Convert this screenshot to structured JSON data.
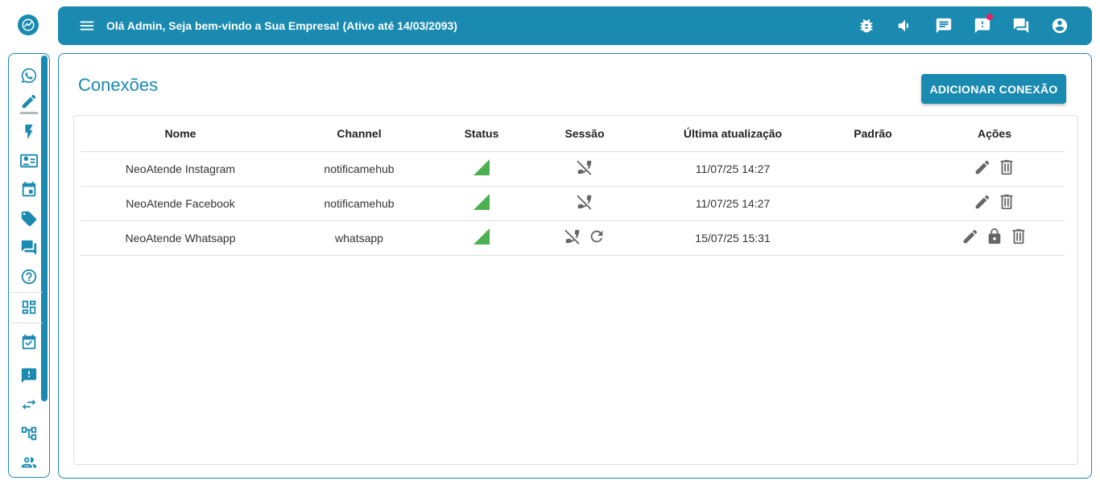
{
  "header": {
    "greeting": "Olá Admin, Seja bem-vindo a Sua Empresa! (Ativo até 14/03/2093)",
    "icons": [
      "bug-icon",
      "volume-icon",
      "chat-note-icon",
      "alert-message-icon",
      "forum-icon",
      "account-icon"
    ],
    "colors": {
      "primary": "#1a8ab0",
      "badge": "#e91e63"
    }
  },
  "sidebar": {
    "icons": [
      "whatsapp-icon",
      "edit-icon",
      "flash-icon",
      "contacts-icon",
      "calendar-icon",
      "tag-icon",
      "forum-icon",
      "help-icon",
      "dashboard-icon",
      "event-check-icon",
      "feedback-icon",
      "swap-icon",
      "flow-icon",
      "users-icon"
    ]
  },
  "main": {
    "title": "Conexões",
    "add_button": "ADICIONAR CONEXÃO",
    "columns": [
      "Nome",
      "Channel",
      "Status",
      "Sessão",
      "Última atualização",
      "Padrão",
      "Ações"
    ],
    "rows": [
      {
        "name": "NeoAtende Instagram",
        "channel": "notificamehub",
        "status": "connected",
        "updated": "11/07/25 14:27",
        "default": ""
      },
      {
        "name": "NeoAtende Facebook",
        "channel": "notificamehub",
        "status": "connected",
        "updated": "11/07/25 14:27",
        "default": ""
      },
      {
        "name": "NeoAtende Whatsapp",
        "channel": "whatsapp",
        "status": "connected",
        "updated": "15/07/25 15:31",
        "default": ""
      }
    ],
    "status_color": "#4caf50"
  }
}
